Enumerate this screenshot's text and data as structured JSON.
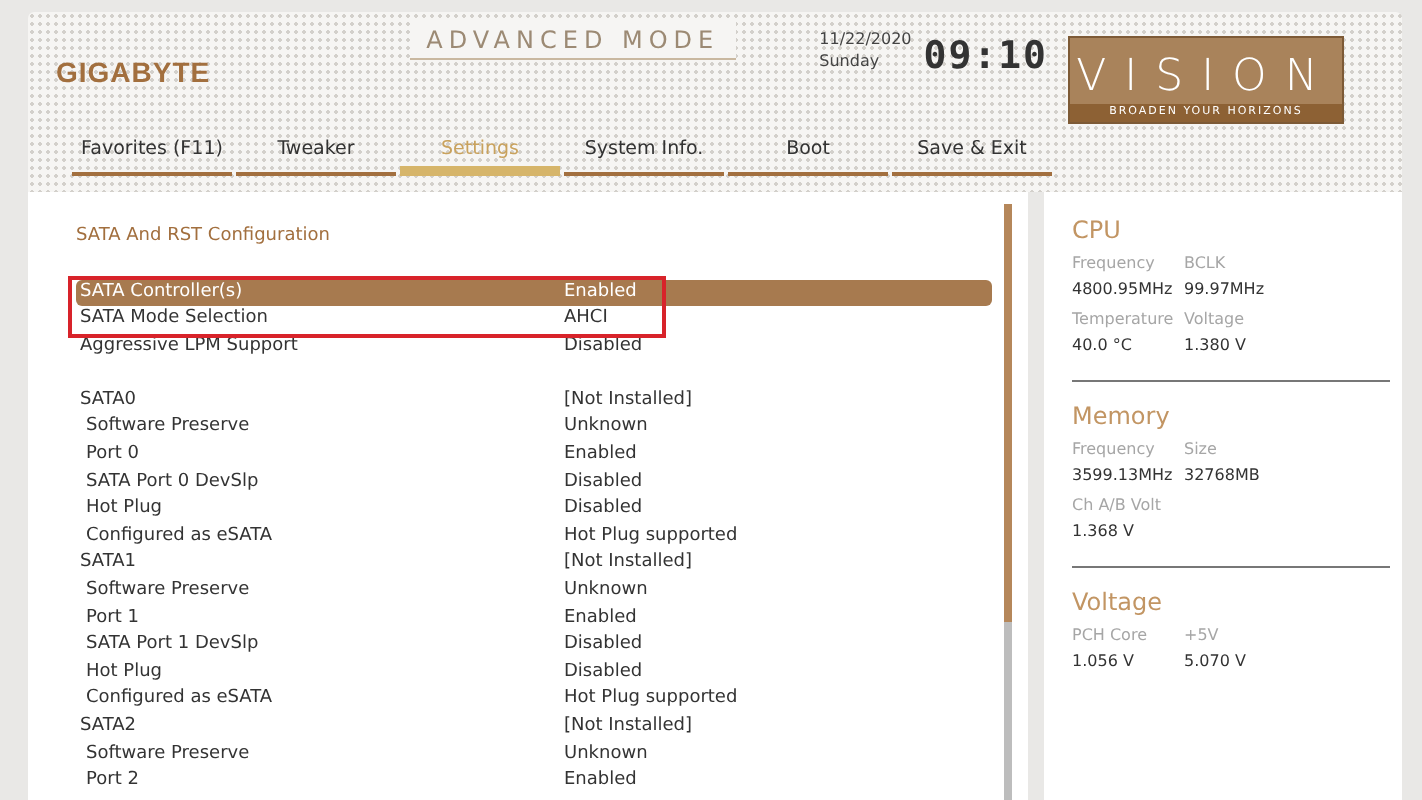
{
  "header": {
    "brand": "GIGABYTE",
    "mode_title": "ADVANCED MODE",
    "date": "11/22/2020",
    "day": "Sunday",
    "time": "09:10",
    "badge": {
      "title": "VISION",
      "tagline": "BROADEN YOUR HORIZONS"
    }
  },
  "tabs": [
    {
      "label": "Favorites (F11)",
      "selected": false
    },
    {
      "label": "Tweaker",
      "selected": false
    },
    {
      "label": "Settings",
      "selected": true
    },
    {
      "label": "System Info.",
      "selected": false
    },
    {
      "label": "Boot",
      "selected": false
    },
    {
      "label": "Save & Exit",
      "selected": false
    }
  ],
  "settings": {
    "title": "SATA And RST Configuration",
    "blocks": [
      {
        "rows": [
          {
            "kind": "item",
            "label": "SATA Controller(s)",
            "value": "Enabled",
            "selected": true,
            "boxed": true
          },
          {
            "kind": "item",
            "label": "SATA Mode Selection",
            "value": "AHCI",
            "selected": false,
            "boxed": true
          },
          {
            "kind": "item",
            "label": "Aggressive LPM Support",
            "value": "Disabled",
            "selected": false,
            "boxed": false
          }
        ]
      },
      {
        "rows": [
          {
            "kind": "group",
            "label": "SATA0",
            "value": "[Not Installed]",
            "selected": false,
            "boxed": false
          },
          {
            "kind": "sub",
            "label": "Software Preserve",
            "value": "Unknown",
            "selected": false,
            "boxed": false
          },
          {
            "kind": "sub",
            "label": "Port 0",
            "value": "Enabled",
            "selected": false,
            "boxed": false
          },
          {
            "kind": "sub",
            "label": "SATA Port 0 DevSlp",
            "value": "Disabled",
            "selected": false,
            "boxed": false
          },
          {
            "kind": "sub",
            "label": "Hot Plug",
            "value": "Disabled",
            "selected": false,
            "boxed": false
          },
          {
            "kind": "sub",
            "label": "Configured as eSATA",
            "value": "Hot Plug supported",
            "selected": false,
            "boxed": false
          },
          {
            "kind": "group",
            "label": "SATA1",
            "value": "[Not Installed]",
            "selected": false,
            "boxed": false
          },
          {
            "kind": "sub",
            "label": "Software Preserve",
            "value": "Unknown",
            "selected": false,
            "boxed": false
          },
          {
            "kind": "sub",
            "label": "Port 1",
            "value": "Enabled",
            "selected": false,
            "boxed": false
          },
          {
            "kind": "sub",
            "label": "SATA Port 1 DevSlp",
            "value": "Disabled",
            "selected": false,
            "boxed": false
          },
          {
            "kind": "sub",
            "label": "Hot Plug",
            "value": "Disabled",
            "selected": false,
            "boxed": false
          },
          {
            "kind": "sub",
            "label": "Configured as eSATA",
            "value": "Hot Plug supported",
            "selected": false,
            "boxed": false
          },
          {
            "kind": "group",
            "label": "SATA2",
            "value": "[Not Installed]",
            "selected": false,
            "boxed": false
          },
          {
            "kind": "sub",
            "label": "Software Preserve",
            "value": "Unknown",
            "selected": false,
            "boxed": false
          },
          {
            "kind": "sub",
            "label": "Port 2",
            "value": "Enabled",
            "selected": false,
            "boxed": false
          }
        ]
      }
    ]
  },
  "hardware_monitor": [
    {
      "title": "CPU",
      "readings": [
        {
          "label": "Frequency",
          "value": "4800.95MHz"
        },
        {
          "label": "BCLK",
          "value": "99.97MHz"
        },
        {
          "label": "Temperature",
          "value": "40.0 °C"
        },
        {
          "label": "Voltage",
          "value": "1.380 V"
        }
      ]
    },
    {
      "title": "Memory",
      "readings": [
        {
          "label": "Frequency",
          "value": "3599.13MHz"
        },
        {
          "label": "Size",
          "value": "32768MB"
        },
        {
          "label": "Ch A/B Volt",
          "value": "1.368 V"
        }
      ]
    },
    {
      "title": "Voltage",
      "readings": [
        {
          "label": "PCH Core",
          "value": "1.056 V"
        },
        {
          "label": "+5V",
          "value": "5.070 V"
        }
      ]
    }
  ]
}
